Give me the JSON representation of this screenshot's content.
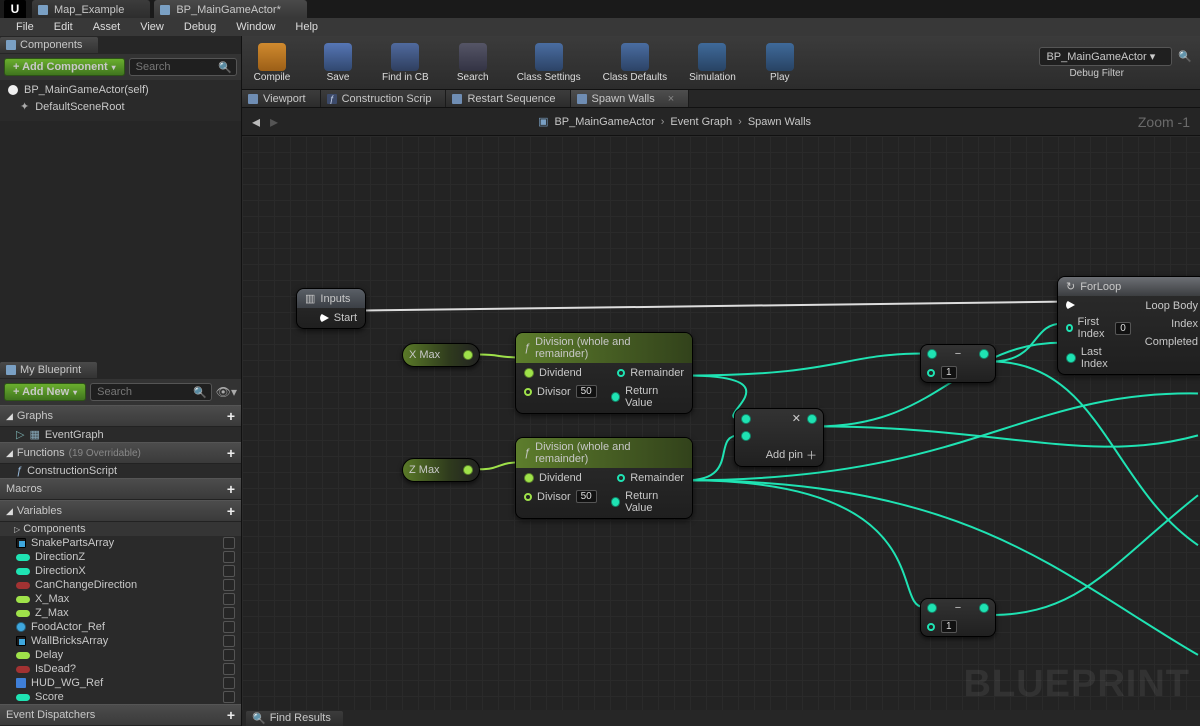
{
  "docTabs": [
    "Map_Example",
    "BP_MainGameActor*"
  ],
  "menu": [
    "File",
    "Edit",
    "Asset",
    "View",
    "Debug",
    "Window",
    "Help"
  ],
  "componentsPanel": {
    "title": "Components",
    "addBtn": "+ Add Component",
    "searchPlaceholder": "Search",
    "items": [
      "BP_MainGameActor(self)",
      "DefaultSceneRoot"
    ]
  },
  "blueprintPanel": {
    "title": "My Blueprint",
    "addBtn": "+ Add New",
    "searchPlaceholder": "Search",
    "cats": {
      "graphs": "Graphs",
      "eventGraph": "EventGraph",
      "functions": "Functions",
      "functionsHint": "(19 Overridable)",
      "construction": "ConstructionScript",
      "macros": "Macros",
      "variables": "Variables",
      "componentsSub": "Components",
      "dispatchers": "Event Dispatchers"
    },
    "vars": [
      {
        "name": "SnakePartsArray",
        "kind": "grid",
        "color": "#3fa7dd"
      },
      {
        "name": "DirectionZ",
        "kind": "pill",
        "color": "#1fe3b3"
      },
      {
        "name": "DirectionX",
        "kind": "pill",
        "color": "#1fe3b3"
      },
      {
        "name": "CanChangeDirection",
        "kind": "pill",
        "color": "#a23232"
      },
      {
        "name": "X_Max",
        "kind": "pill",
        "color": "#9fe24a"
      },
      {
        "name": "Z_Max",
        "kind": "pill",
        "color": "#9fe24a"
      },
      {
        "name": "FoodActor_Ref",
        "kind": "dot",
        "color": "#3fa7dd"
      },
      {
        "name": "WallBricksArray",
        "kind": "grid",
        "color": "#3fa7dd"
      },
      {
        "name": "Delay",
        "kind": "pill",
        "color": "#9fe24a"
      },
      {
        "name": "IsDead?",
        "kind": "pill",
        "color": "#a23232"
      },
      {
        "name": "HUD_WG_Ref",
        "kind": "sq",
        "color": "#3f7fd8"
      },
      {
        "name": "Score",
        "kind": "pill",
        "color": "#1fe3b3"
      }
    ]
  },
  "toolbar": [
    {
      "label": "Compile",
      "cls": "ico-compile"
    },
    {
      "label": "Save",
      "cls": "ico-save"
    },
    {
      "label": "Find in CB",
      "cls": "ico-find"
    },
    {
      "label": "Search",
      "cls": "ico-search"
    },
    {
      "label": "Class Settings",
      "cls": "ico-csettings"
    },
    {
      "label": "Class Defaults",
      "cls": "ico-cdef"
    },
    {
      "label": "Simulation",
      "cls": "ico-sim"
    },
    {
      "label": "Play",
      "cls": "ico-play"
    }
  ],
  "debugCombo": "BP_MainGameActor",
  "debugFilterLabel": "Debug Filter",
  "subTabs": [
    {
      "label": "Viewport",
      "t": "ti"
    },
    {
      "label": "Construction Scrip",
      "t": "tf"
    },
    {
      "label": "Restart Sequence",
      "t": "ti"
    },
    {
      "label": "Spawn Walls",
      "t": "ti",
      "active": true
    }
  ],
  "breadcrumb": [
    "BP_MainGameActor",
    "Event Graph",
    "Spawn Walls"
  ],
  "zoom": "Zoom -1",
  "watermark": "BLUEPRINT",
  "nodes": {
    "inputs": {
      "title": "Inputs",
      "start": "Start"
    },
    "div": {
      "title": "Division (whole and remainder)",
      "dividend": "Dividend",
      "divisor": "Divisor",
      "divVal": "50",
      "remainder": "Remainder",
      "ret": "Return Value"
    },
    "xmax": "X Max",
    "zmax": "Z Max",
    "addpin": "Add pin",
    "one": "1",
    "forloop": {
      "title": "ForLoop",
      "first": "First Index",
      "firstVal": "0",
      "last": "Last Index",
      "loopBody": "Loop Body",
      "index": "Index",
      "completed": "Completed"
    }
  },
  "findResults": "Find Results"
}
